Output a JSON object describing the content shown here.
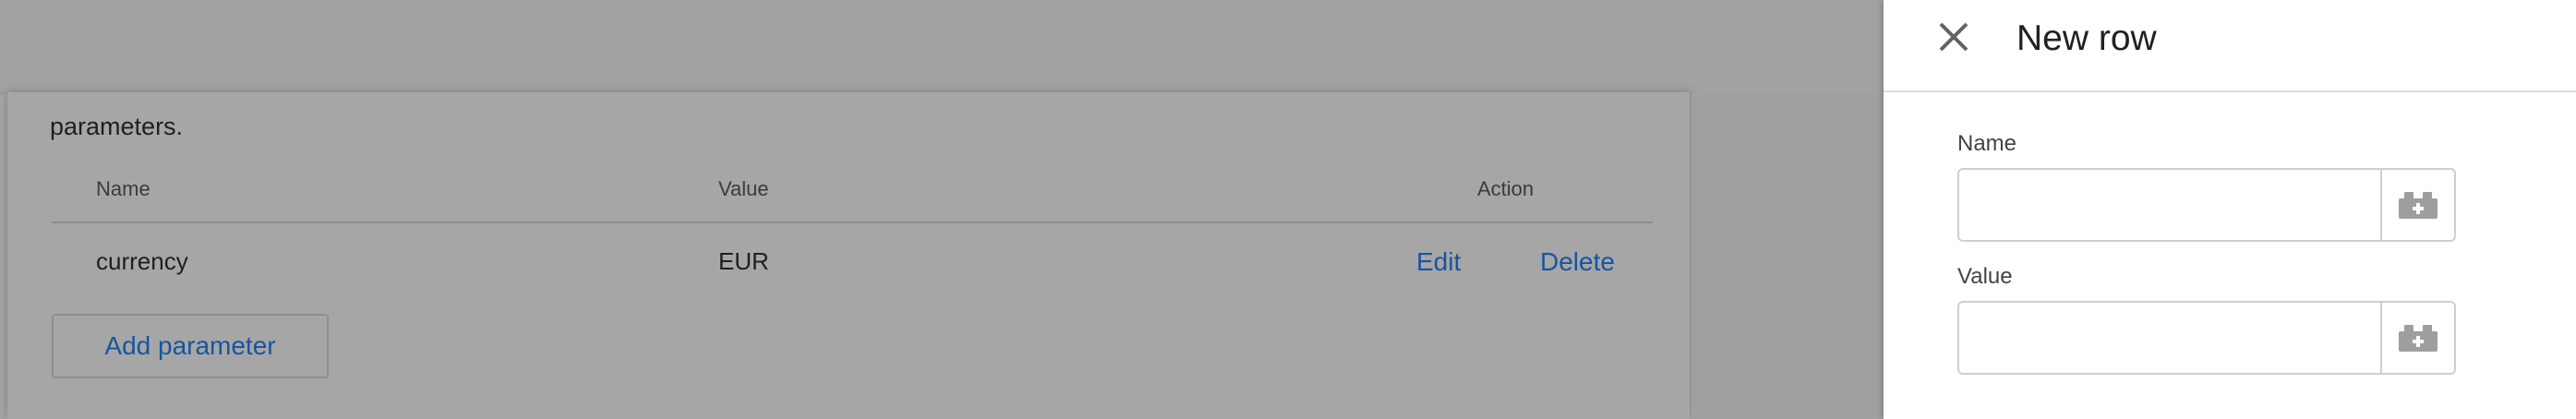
{
  "parameters_section": {
    "description_end": "parameters.",
    "columns": {
      "name": "Name",
      "value": "Value",
      "action": "Action"
    },
    "rows": [
      {
        "name": "currency",
        "value": "EUR",
        "edit_label": "Edit",
        "delete_label": "Delete"
      }
    ],
    "add_button_label": "Add parameter"
  },
  "side_panel": {
    "title": "New row",
    "close_icon": "close-icon",
    "fields": [
      {
        "label": "Name",
        "value": "",
        "variable_icon": "lego-plus-icon"
      },
      {
        "label": "Value",
        "value": "",
        "variable_icon": "lego-plus-icon"
      }
    ]
  },
  "colors": {
    "link": "#1655a0",
    "overlay": "#a6a6a6",
    "panel_bg": "#ffffff"
  }
}
